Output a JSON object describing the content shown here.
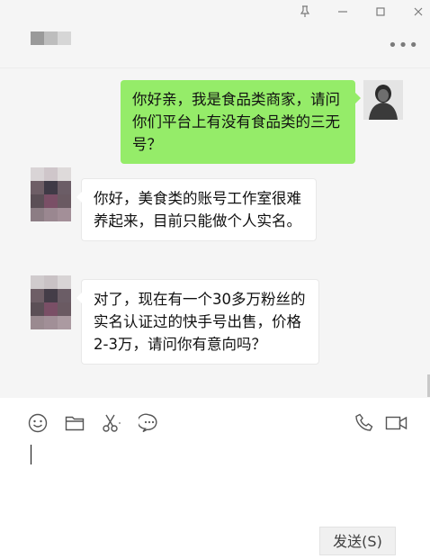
{
  "window": {
    "controls": [
      {
        "name": "pin-icon",
        "glyph": "⊥"
      },
      {
        "name": "minimize-icon",
        "glyph": "—"
      },
      {
        "name": "maximize-icon",
        "glyph": "☐"
      },
      {
        "name": "close-icon",
        "glyph": "✕"
      }
    ],
    "more_glyph": "•••"
  },
  "messages": [
    {
      "direction": "out",
      "text": "你好亲，我是食品类商家，请问你们平台上有没有食品类的三无号？"
    },
    {
      "direction": "in",
      "text": "你好，美食类的账号工作室很难养起来，目前只能做个人实名。"
    },
    {
      "direction": "in",
      "text": "对了，现在有一个30多万粉丝的实名认证过的快手号出售，价格2-3万，请问你有意向吗？"
    }
  ],
  "toolbar": {
    "icons": [
      "emoji-icon",
      "folder-icon",
      "scissors-icon",
      "chat-icon",
      "phone-icon",
      "video-icon"
    ]
  },
  "input": {
    "value": ""
  },
  "send_button": {
    "label": "发送(S)"
  },
  "colors": {
    "outgoing_bubble": "#95ec69",
    "incoming_bubble": "#ffffff",
    "background": "#f5f5f5"
  }
}
